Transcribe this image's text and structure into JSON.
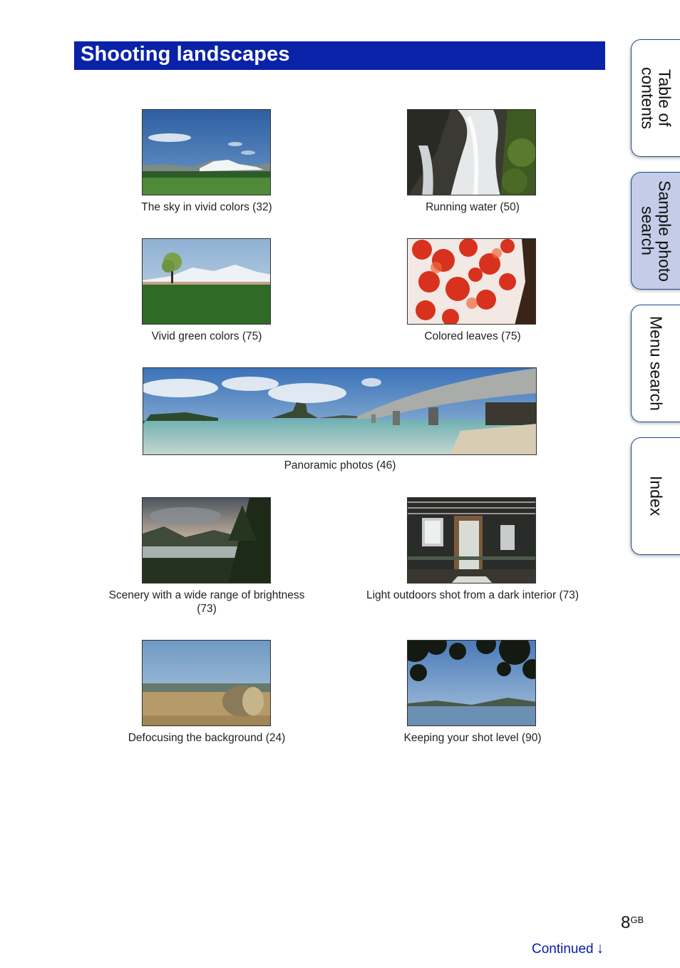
{
  "page": {
    "title": "Shooting landscapes",
    "page_number": "8",
    "page_suffix": "GB",
    "continued_label": "Continued",
    "continued_icon": "down-arrow-icon"
  },
  "side_tabs": [
    {
      "label": "Table of\ncontents",
      "active": false
    },
    {
      "label": "Sample photo\nsearch",
      "active": true
    },
    {
      "label": "Menu search",
      "active": false
    },
    {
      "label": "Index",
      "active": false
    }
  ],
  "photos": [
    {
      "caption": "The sky in vivid colors (32)",
      "scene": "blue sky with clouds, snowy mountains, green field"
    },
    {
      "caption": "Running water (50)",
      "scene": "waterfall with rocks and foliage"
    },
    {
      "caption": "Vivid green colors (75)",
      "scene": "lone tree, mountains, green field"
    },
    {
      "caption": "Colored leaves (75)",
      "scene": "red maple leaves"
    },
    {
      "caption": "Panoramic photos (46)",
      "scene": "panorama of sea, islands and bridge"
    },
    {
      "caption": "Scenery with a wide range of brightness\n(73)",
      "scene": "lake with forest at dusk"
    },
    {
      "caption": "Light outdoors shot from a dark interior (73)",
      "scene": "dark room with open door"
    },
    {
      "caption": "Defocusing the background (24)",
      "scene": "hay bale in wheat field"
    },
    {
      "caption": "Keeping your shot level (90)",
      "scene": "lake framed by leaves"
    }
  ]
}
